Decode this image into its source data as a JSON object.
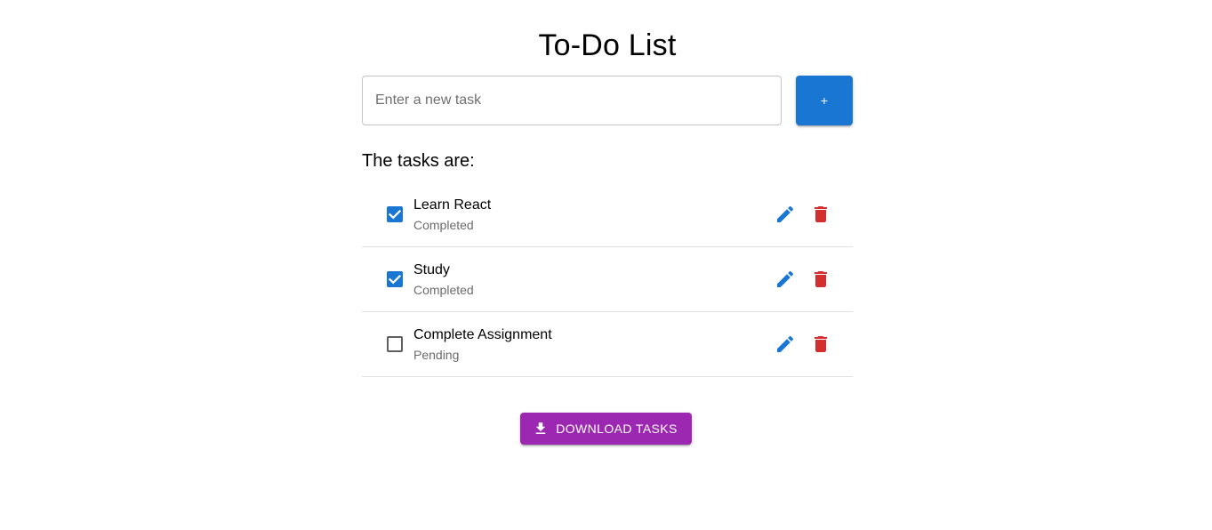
{
  "title": "To-Do List",
  "add_form": {
    "input_placeholder": "Enter a new task",
    "input_value": "",
    "add_button_label": "+"
  },
  "tasks_heading": "The tasks are:",
  "tasks": [
    {
      "name": "Learn React",
      "status": "Completed",
      "checked": true
    },
    {
      "name": "Study",
      "status": "Completed",
      "checked": true
    },
    {
      "name": "Complete Assignment",
      "status": "Pending",
      "checked": false
    }
  ],
  "icons": {
    "edit": "pencil-icon",
    "delete": "trash-icon",
    "download": "download-icon",
    "check": "check-icon"
  },
  "download_button_label": "DOWNLOAD TASKS",
  "colors": {
    "primary": "#1976d2",
    "delete": "#d32f2f",
    "download": "#9c27b0",
    "secondary_text": "#6b6b6b"
  }
}
